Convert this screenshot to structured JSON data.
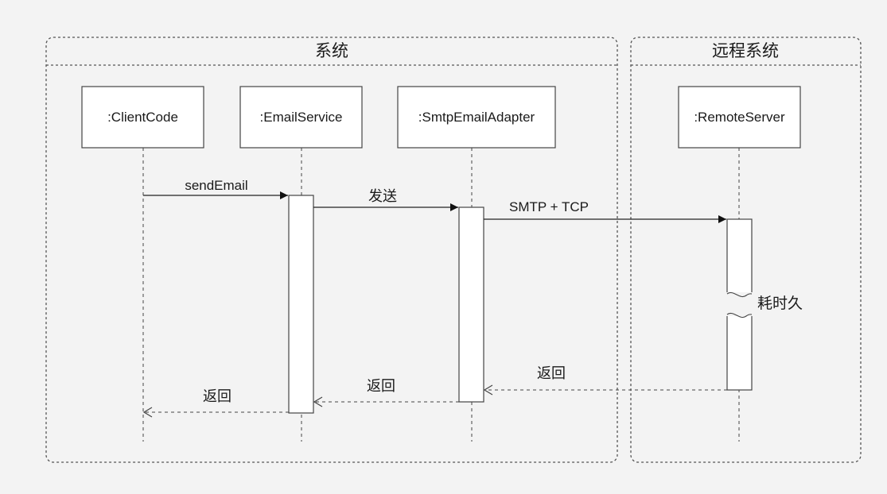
{
  "frames": {
    "system": {
      "title": "系统"
    },
    "remote": {
      "title": "远程系统"
    }
  },
  "participants": [
    {
      "id": "client",
      "label": ":ClientCode"
    },
    {
      "id": "email",
      "label": ":EmailService"
    },
    {
      "id": "smtp",
      "label": ":SmtpEmailAdapter"
    },
    {
      "id": "remote",
      "label": ":RemoteServer"
    }
  ],
  "messages": {
    "send_email": "sendEmail",
    "send": "发送",
    "smtp_tcp": "SMTP + TCP",
    "return_remote": "返回",
    "return_smtp": "返回",
    "return_email": "返回"
  },
  "notes": {
    "long_time": "耗时久"
  }
}
